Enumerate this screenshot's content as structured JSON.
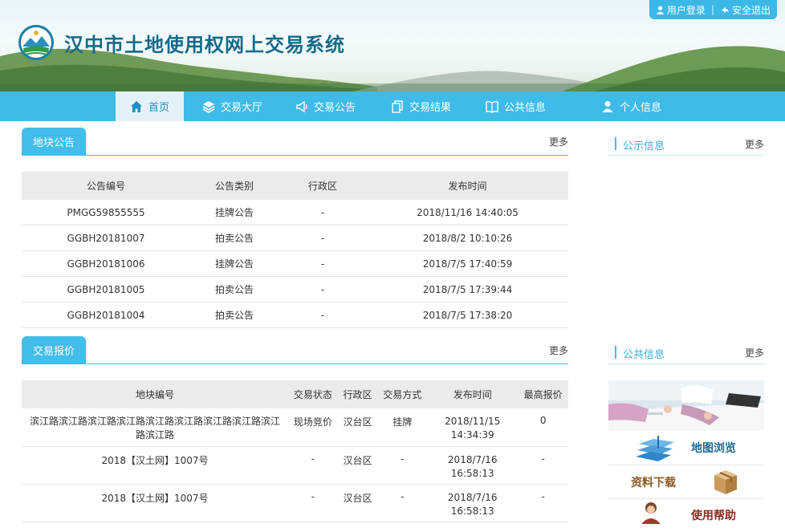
{
  "header": {
    "site_title": "汉中市土地使用权网上交易系统",
    "login_label": "用户登录",
    "separator": "|",
    "logout_label": "安全退出"
  },
  "nav": {
    "items": [
      {
        "label": "首页",
        "icon": "home-icon",
        "active": true
      },
      {
        "label": "交易大厅",
        "icon": "layers-icon"
      },
      {
        "label": "交易公告",
        "icon": "megaphone-icon"
      },
      {
        "label": "交易结果",
        "icon": "documents-icon"
      },
      {
        "label": "公共信息",
        "icon": "book-icon"
      },
      {
        "label": "个人信息",
        "icon": "user-icon"
      }
    ]
  },
  "land_notices": {
    "tab_label": "地块公告",
    "more_label": "更多",
    "columns": [
      "公告编号",
      "公告类别",
      "行政区",
      "发布时间"
    ],
    "rows": [
      [
        "PMGG59855555",
        "挂牌公告",
        "-",
        "2018/11/16 14:40:05"
      ],
      [
        "GGBH20181007",
        "拍卖公告",
        "-",
        "2018/8/2 10:10:26"
      ],
      [
        "GGBH20181006",
        "挂牌公告",
        "-",
        "2018/7/5 17:40:59"
      ],
      [
        "GGBH20181005",
        "拍卖公告",
        "-",
        "2018/7/5 17:39:44"
      ],
      [
        "GGBH20181004",
        "拍卖公告",
        "-",
        "2018/7/5 17:38:20"
      ]
    ]
  },
  "quotes": {
    "tab_label": "交易报价",
    "more_label": "更多",
    "columns": [
      "地块编号",
      "交易状态",
      "行政区",
      "交易方式",
      "发布时间",
      "最高报价"
    ],
    "rows": [
      [
        "滨江路滨江路滨江路滨江路滨江路滨江路滨江路滨江路滨江路滨江路",
        "现场竞价",
        "汉台区",
        "挂牌",
        "2018/11/15 14:34:39",
        "0"
      ],
      [
        "2018【汉土网】1007号",
        "-",
        "汉台区",
        "-",
        "2018/7/16 16:58:13",
        "-"
      ],
      [
        "2018【汉土网】1007号",
        "-",
        "汉台区",
        "-",
        "2018/7/16 16:58:13",
        "-"
      ]
    ]
  },
  "sidebar": {
    "publicity": {
      "title": "公示信息",
      "more_label": "更多"
    },
    "public_info": {
      "title": "公共信息",
      "more_label": "更多"
    },
    "links": [
      {
        "label": "地图浏览",
        "icon": "map-icon"
      },
      {
        "label": "资料下载",
        "icon": "package-icon"
      },
      {
        "label": "使用帮助",
        "icon": "help-person-icon"
      }
    ]
  },
  "colors": {
    "accent": "#3fbbe8",
    "title": "#156a88",
    "active_bg": "#e3f2f9"
  }
}
